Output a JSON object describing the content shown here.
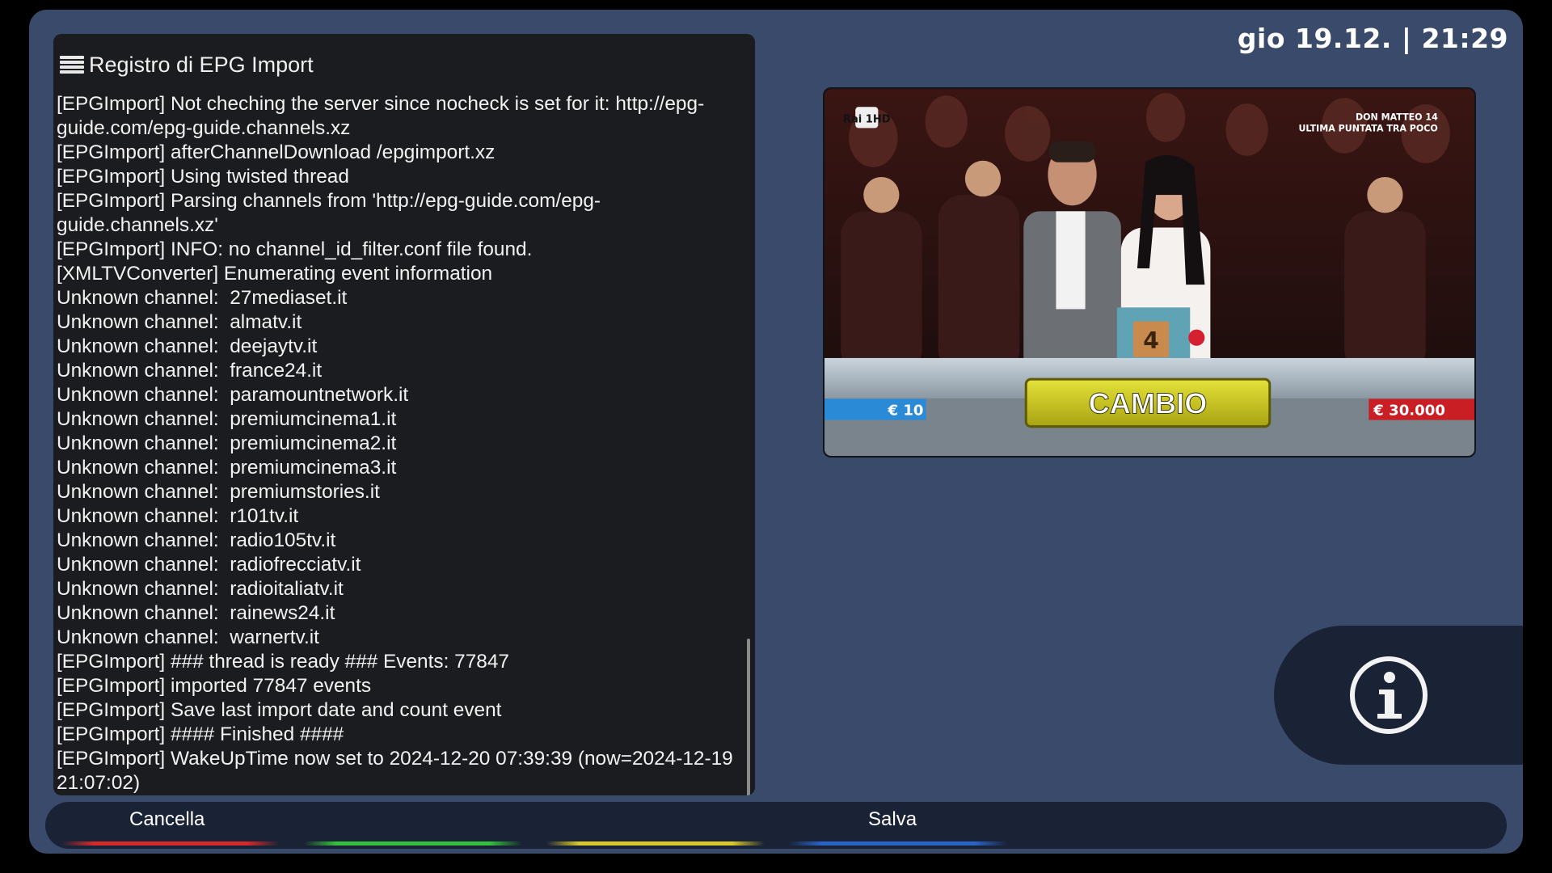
{
  "header": {
    "datetime": "gio 19.12. | 21:29"
  },
  "log": {
    "title": "Registro di EPG Import",
    "lines": [
      "[EPGImport] Not cheching the server since nocheck is set for it: http://epg-guide.com/epg-guide.channels.xz",
      "[EPGImport] afterChannelDownload /epgimport.xz",
      "[EPGImport] Using twisted thread",
      "[EPGImport] Parsing channels from 'http://epg-guide.com/epg-guide.channels.xz'",
      "[EPGImport] INFO: no channel_id_filter.conf file found.",
      "[XMLTVConverter] Enumerating event information",
      "Unknown channel:  27mediaset.it",
      "Unknown channel:  almatv.it",
      "Unknown channel:  deejaytv.it",
      "Unknown channel:  france24.it",
      "Unknown channel:  paramountnetwork.it",
      "Unknown channel:  premiumcinema1.it",
      "Unknown channel:  premiumcinema2.it",
      "Unknown channel:  premiumcinema3.it",
      "Unknown channel:  premiumstories.it",
      "Unknown channel:  r101tv.it",
      "Unknown channel:  radio105tv.it",
      "Unknown channel:  radiofrecciatv.it",
      "Unknown channel:  radioitaliatv.it",
      "Unknown channel:  rainews24.it",
      "Unknown channel:  warnertv.it",
      "[EPGImport] ### thread is ready ### Events: 77847",
      "[EPGImport] imported 77847 events",
      "[EPGImport] Save last import date and count event",
      "[EPGImport] #### Finished ####",
      "[EPGImport] WakeUpTime now set to 2024-12-20 07:39:39 (now=2024-12-19 21:07:02)"
    ]
  },
  "preview": {
    "channel_logo": "Rai 1HD",
    "overlay_line1": "DON MATTEO 14",
    "overlay_line2": "ULTIMA PUNTATA TRA POCO",
    "banner": "CAMBIO",
    "left_value": "€ 10",
    "right_value": "€ 30.000",
    "box_number": "4"
  },
  "buttons": {
    "red_label": "Cancella",
    "green_label": "Salva"
  },
  "icons": {
    "menu": "menu-icon",
    "info": "info-icon"
  },
  "colors": {
    "red": "#d42a2a",
    "green": "#34c23a",
    "yellow": "#d9c82a",
    "blue": "#2a64c8"
  }
}
